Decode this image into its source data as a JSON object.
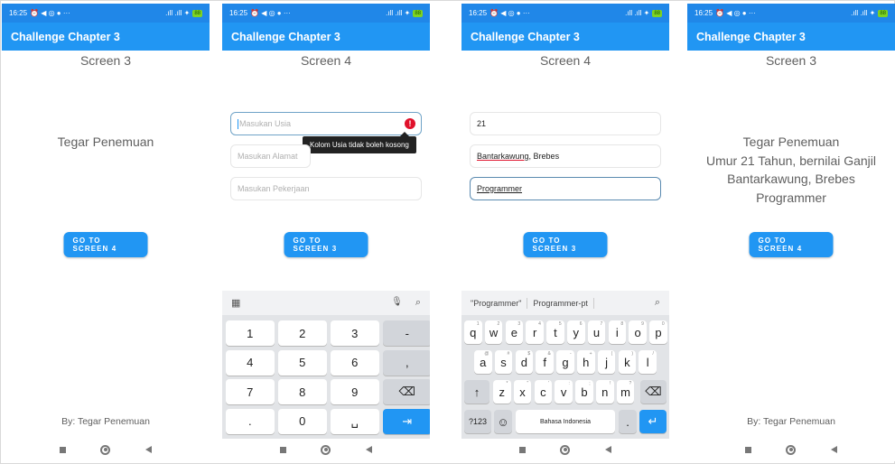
{
  "status": {
    "time": "16:25",
    "icons": "⏰ ◀ ◎ ● ···",
    "right": ".ıll .ıll ✦",
    "battery": "88"
  },
  "app_title": "Challenge Chapter 3",
  "screen1": {
    "title": "Screen 3",
    "name": "Tegar Penemuan",
    "button": "GO TO SCREEN 4",
    "footer": "By: Tegar Penemuan"
  },
  "screen2": {
    "title": "Screen 4",
    "age_placeholder": "Masukan Usia",
    "address_placeholder": "Masukan Alamat",
    "job_placeholder": "Masukan Pekerjaan",
    "error_tooltip": "Kolom Usia tidak boleh kosong",
    "button": "GO TO SCREEN 3",
    "keyboard": {
      "rows": [
        [
          "1",
          "2",
          "3",
          "-"
        ],
        [
          "4",
          "5",
          "6",
          ","
        ],
        [
          "7",
          "8",
          "9",
          "⌫"
        ],
        [
          ".",
          "0",
          "␣",
          "⇥"
        ]
      ]
    }
  },
  "screen3": {
    "title": "Screen 4",
    "age_value": "21",
    "address_underlined": "Bantarkawung",
    "address_rest": ", Brebes",
    "job_value": "Programmer",
    "button": "GO TO SCREEN 3",
    "keyboard": {
      "suggestions": [
        "\"Programmer\"",
        "Programmer-pt"
      ],
      "row1": [
        "q",
        "w",
        "e",
        "r",
        "t",
        "y",
        "u",
        "i",
        "o",
        "p"
      ],
      "row1_sup": [
        "1",
        "2",
        "3",
        "4",
        "5",
        "6",
        "7",
        "8",
        "9",
        "0"
      ],
      "row2": [
        "a",
        "s",
        "d",
        "f",
        "g",
        "h",
        "j",
        "k",
        "l"
      ],
      "row2_sup": [
        "@",
        "#",
        "$",
        "&",
        "-",
        "+",
        "(",
        ")",
        "/"
      ],
      "row3": [
        "z",
        "x",
        "c",
        "v",
        "b",
        "n",
        "m"
      ],
      "row3_sup": [
        "*",
        "\"",
        "'",
        ":",
        ";",
        "!",
        "?"
      ],
      "shift": "↑",
      "backspace": "⌫",
      "sym": "?123",
      "emoji": "☺",
      "space": "Bahasa Indonesia",
      "dot": ".",
      "enter": "↵"
    }
  },
  "screen4": {
    "title": "Screen 3",
    "lines": [
      "Tegar Penemuan",
      "Umur 21 Tahun, bernilai Ganjil",
      "Bantarkawung, Brebes",
      "Programmer"
    ],
    "button": "GO TO SCREEN 4",
    "footer": "By: Tegar Penemuan"
  }
}
